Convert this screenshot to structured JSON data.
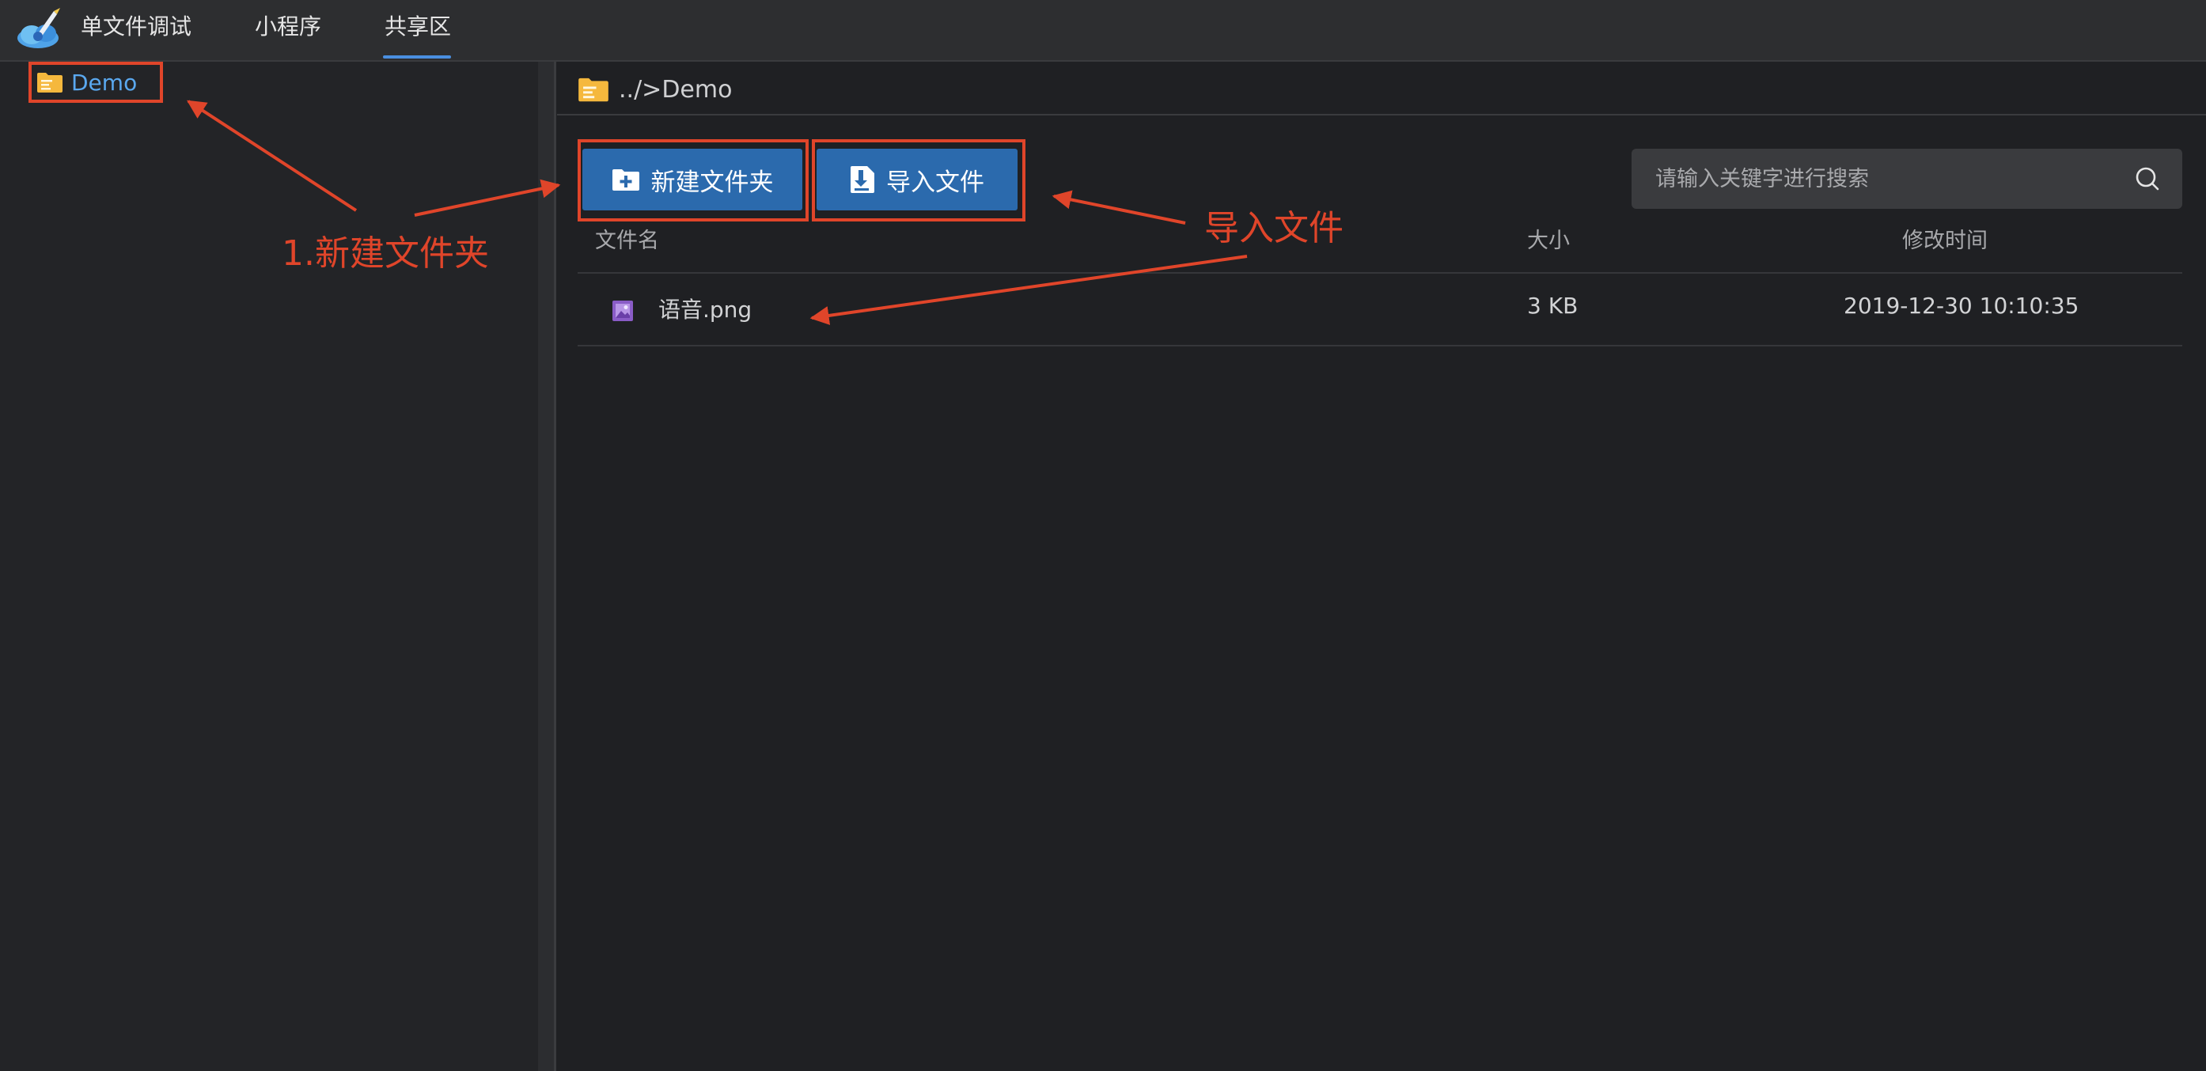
{
  "nav": {
    "tabs": [
      {
        "label": "单文件调试"
      },
      {
        "label": "小程序"
      },
      {
        "label": "共享区",
        "active": true
      }
    ],
    "accent_color": "#4a8fe0"
  },
  "sidebar": {
    "items": [
      {
        "label": "Demo",
        "icon": "folder-icon"
      }
    ]
  },
  "main": {
    "breadcrumb": "../>Demo",
    "toolbar": {
      "new_folder_label": "新建文件夹",
      "import_label": "导入文件",
      "button_color": "#2b6aad"
    },
    "search": {
      "placeholder": "请输入关键字进行搜索",
      "value": ""
    },
    "table": {
      "columns": [
        "文件名",
        "大小",
        "修改时间"
      ],
      "rows": [
        {
          "name": "语音.png",
          "size": "3 KB",
          "modified": "2019-12-30 10:10:35",
          "icon": "image-file-icon"
        }
      ]
    }
  },
  "annotations": {
    "color": "#e0452a",
    "new_folder_note": "1.新建文件夹",
    "import_note": "导入文件"
  }
}
